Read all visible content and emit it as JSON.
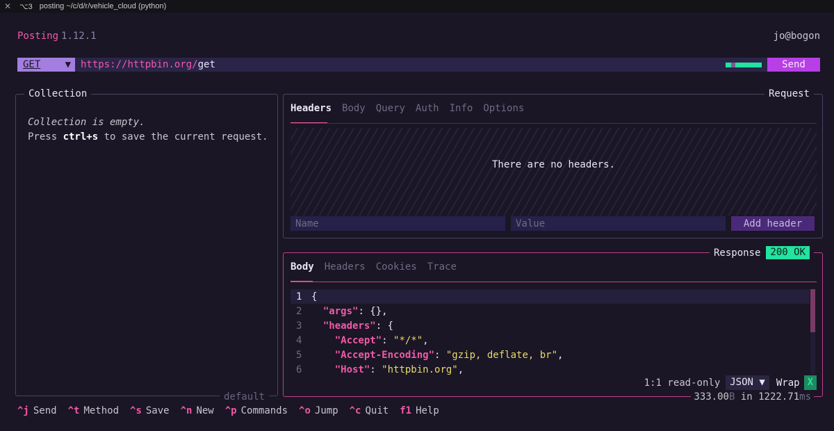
{
  "window": {
    "shortcut": "⌥3",
    "title": "posting ~/c/d/r/vehicle_cloud (python)"
  },
  "app": {
    "name": "Posting",
    "version": "1.12.1",
    "user": "jo@bogon"
  },
  "url_bar": {
    "method": "GET",
    "url_scheme": "https://",
    "url_host": "httpbin.org/",
    "url_path": "get",
    "send_label": "Send"
  },
  "collection": {
    "title": "Collection",
    "empty_text": "Collection is empty.",
    "hint_pre": "Press ",
    "hint_key": "ctrl+s",
    "hint_post": " to save the current request.",
    "footer_tag": "default"
  },
  "request": {
    "title": "Request",
    "tabs": [
      "Headers",
      "Body",
      "Query",
      "Auth",
      "Info",
      "Options"
    ],
    "active_tab": "Headers",
    "empty_headers": "There are no headers.",
    "name_placeholder": "Name",
    "value_placeholder": "Value",
    "add_header_label": "Add header"
  },
  "response": {
    "title": "Response",
    "status": "200 OK",
    "tabs": [
      "Body",
      "Headers",
      "Cookies",
      "Trace"
    ],
    "active_tab": "Body",
    "lines": [
      {
        "n": "1",
        "text": "{"
      },
      {
        "n": "2",
        "text": "  \"args\": {},"
      },
      {
        "n": "3",
        "text": "  \"headers\": {"
      },
      {
        "n": "4",
        "text": "    \"Accept\": \"*/*\","
      },
      {
        "n": "5",
        "text": "    \"Accept-Encoding\": \"gzip, deflate, br\","
      },
      {
        "n": "6",
        "text": "    \"Host\": \"httpbin.org\","
      }
    ],
    "cursor_pos": "1:1 read-only",
    "format": "JSON",
    "wrap_label": "Wrap",
    "wrap_toggle": "X",
    "size": "333.00",
    "size_unit": "B",
    "time_pre": " in ",
    "time": "1222.71",
    "time_unit": "ms"
  },
  "footer_keys": [
    {
      "key": "^j",
      "label": "Send"
    },
    {
      "key": "^t",
      "label": "Method"
    },
    {
      "key": "^s",
      "label": "Save"
    },
    {
      "key": "^n",
      "label": "New"
    },
    {
      "key": "^p",
      "label": "Commands"
    },
    {
      "key": "^o",
      "label": "Jump"
    },
    {
      "key": "^c",
      "label": "Quit"
    },
    {
      "key": "f1",
      "label": "Help"
    }
  ],
  "colors": {
    "accent_pink": "#f05aa8",
    "accent_purple": "#b83ee6",
    "success_green": "#22e3a0",
    "background": "#1a1625"
  }
}
